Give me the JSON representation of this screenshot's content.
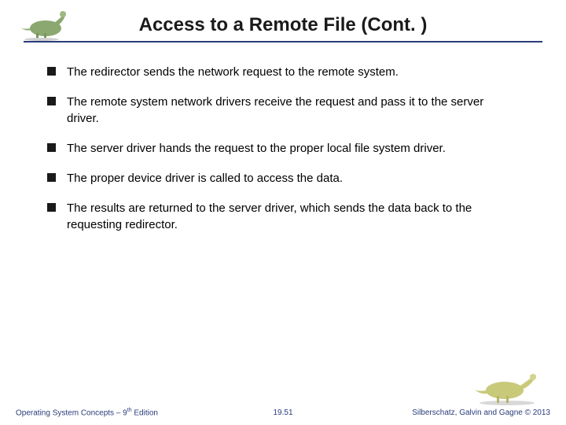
{
  "title": "Access to a Remote File (Cont. )",
  "bullets": [
    "The redirector sends the network request to the remote system.",
    "The remote system network drivers receive the request and pass it to the server driver.",
    "The server driver hands the request to the proper local file system driver.",
    "The proper device driver is called to access the data.",
    "The results are returned to the server driver, which sends the data back to the requesting redirector."
  ],
  "footer": {
    "left_prefix": "Operating System Concepts – 9",
    "left_suffix": " Edition",
    "left_sup": "th",
    "center": "19.51",
    "right": "Silberschatz, Galvin and Gagne © 2013"
  }
}
